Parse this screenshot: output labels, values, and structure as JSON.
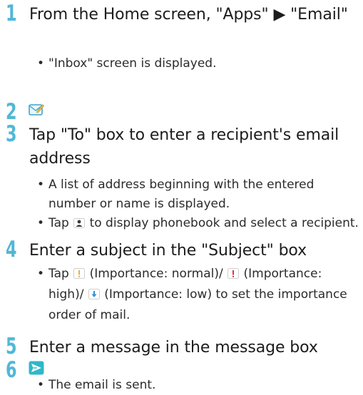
{
  "steps": [
    {
      "number": "1",
      "title": "From the Home screen, \"Apps\" ▶ \"Email\"",
      "bullets": [
        "\"Inbox\" screen is displayed."
      ]
    },
    {
      "number": "2",
      "icon": "compose-email-icon"
    },
    {
      "number": "3",
      "title": "Tap \"To\" box to enter a recipient's email address",
      "bullets": [
        "A list of address beginning with the entered number or name is displayed.",
        {
          "before": "Tap ",
          "icon": "person-icon",
          "after": " to display phonebook and select a recipient."
        }
      ]
    },
    {
      "number": "4",
      "title": "Enter a subject in the \"Subject\" box",
      "bullets": [
        {
          "p1": "Tap ",
          "icon1": "importance-normal-icon",
          "p2": " (Importance: normal)/ ",
          "icon2": "importance-high-icon",
          "p3": " (Importance: high)/ ",
          "icon3": "importance-low-icon",
          "p4": " (Importance: low) to set the importance order of mail."
        }
      ]
    },
    {
      "number": "5",
      "title": "Enter a message in the message box"
    },
    {
      "number": "6",
      "icon": "send-icon",
      "bullets": [
        "The email is sent."
      ]
    }
  ],
  "colors": {
    "step_number": "#52b7d7",
    "text": "#1c1c1c"
  }
}
